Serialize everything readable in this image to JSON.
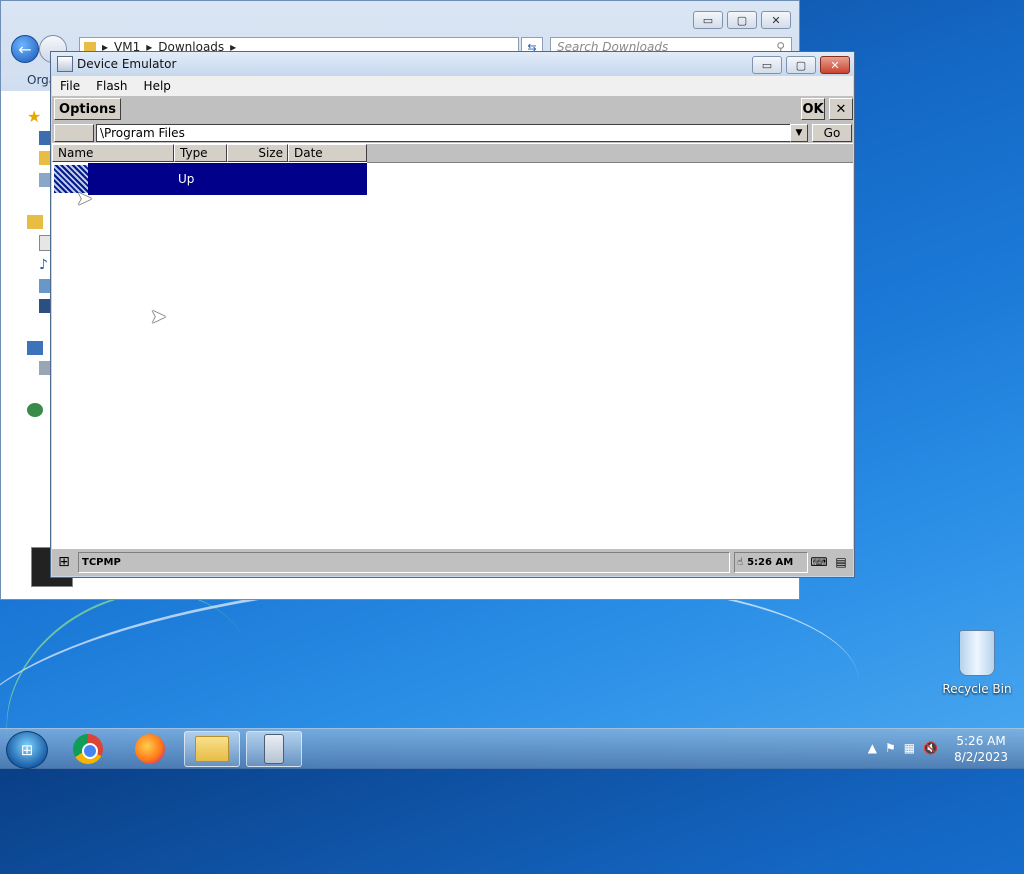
{
  "explorer": {
    "breadcrumb": [
      "VM1",
      "Downloads"
    ],
    "search_placeholder": "Search Downloads",
    "organize_label": "Orga",
    "minimize": "▭",
    "maximize": "▢",
    "close": "✕"
  },
  "emulator": {
    "title": "Device Emulator",
    "menu": [
      "File",
      "Flash",
      "Help"
    ],
    "minimize": "▭",
    "maximize": "▢",
    "close": "✕"
  },
  "device": {
    "options_label": "Options",
    "ok_label": "OK",
    "close_label": "✕",
    "path_value": "\\Program Files",
    "go_label": "Go",
    "columns": [
      "Name",
      "Type",
      "Size",
      "Date"
    ],
    "rows": [
      {
        "name": "Up",
        "selected": true
      }
    ],
    "taskbar_app": "TCPMP",
    "taskbar_time": "5:26 AM"
  },
  "desktop": {
    "recycle_bin_label": "Recycle Bin"
  },
  "taskbar": {
    "time": "5:26 AM",
    "date": "8/2/2023",
    "tray_icons": [
      "show-hidden-icons-arrow",
      "action-center-flag-icon",
      "network-icon",
      "volume-muted-icon"
    ],
    "pinned": [
      "chrome-icon",
      "firefox-icon",
      "file-explorer-icon",
      "device-emulator-icon"
    ]
  },
  "colors": {
    "selection": "#00008a",
    "ce_gray": "#c0c0c0",
    "desktop_blue": "#1b78d6"
  }
}
